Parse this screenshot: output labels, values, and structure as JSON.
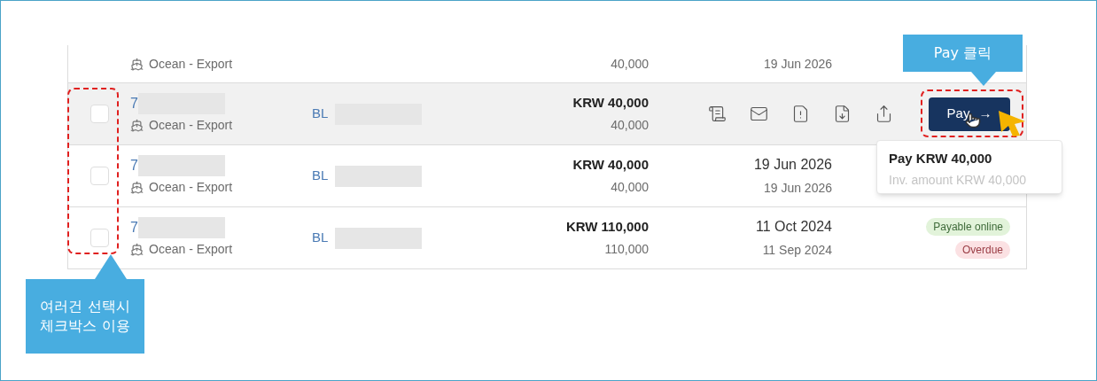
{
  "partial_row": {
    "mode": "Ocean - Export",
    "amount_local": "40,000",
    "due_date": "19 Jun 2026"
  },
  "rows": [
    {
      "id_prefix": "7",
      "mode": "Ocean - Export",
      "bl_prefix": "BL",
      "amount": "KRW 40,000",
      "amount_local": "40,000",
      "hovered": true,
      "checked": false,
      "pay_button": {
        "label": "Pay",
        "arrow": "→"
      }
    },
    {
      "id_prefix": "7",
      "mode": "Ocean - Export",
      "bl_prefix": "BL",
      "amount": "KRW 40,000",
      "amount_local": "40,000",
      "due_date": "19 Jun 2026",
      "issue_date": "19 Jun 2026",
      "hovered": false,
      "checked": false
    },
    {
      "id_prefix": "7",
      "mode": "Ocean - Export",
      "bl_prefix": "BL",
      "amount": "KRW 110,000",
      "amount_local": "110,000",
      "due_date": "11 Oct 2024",
      "issue_date": "11 Sep 2024",
      "hovered": false,
      "checked": false,
      "badges": [
        {
          "label": "Payable online",
          "color": "#e2f3da"
        },
        {
          "label": "Overdue",
          "color": "#fbe1e3"
        }
      ]
    }
  ],
  "tooltip": {
    "title": "Pay KRW 40,000",
    "subtitle": "Inv. amount KRW 40,000"
  },
  "annotations": [
    {
      "kind": "pay",
      "lines": [
        "Pay 클릭"
      ]
    },
    {
      "kind": "checkbox",
      "lines": [
        "여러건 선택시",
        "체크박스 이용"
      ]
    }
  ]
}
